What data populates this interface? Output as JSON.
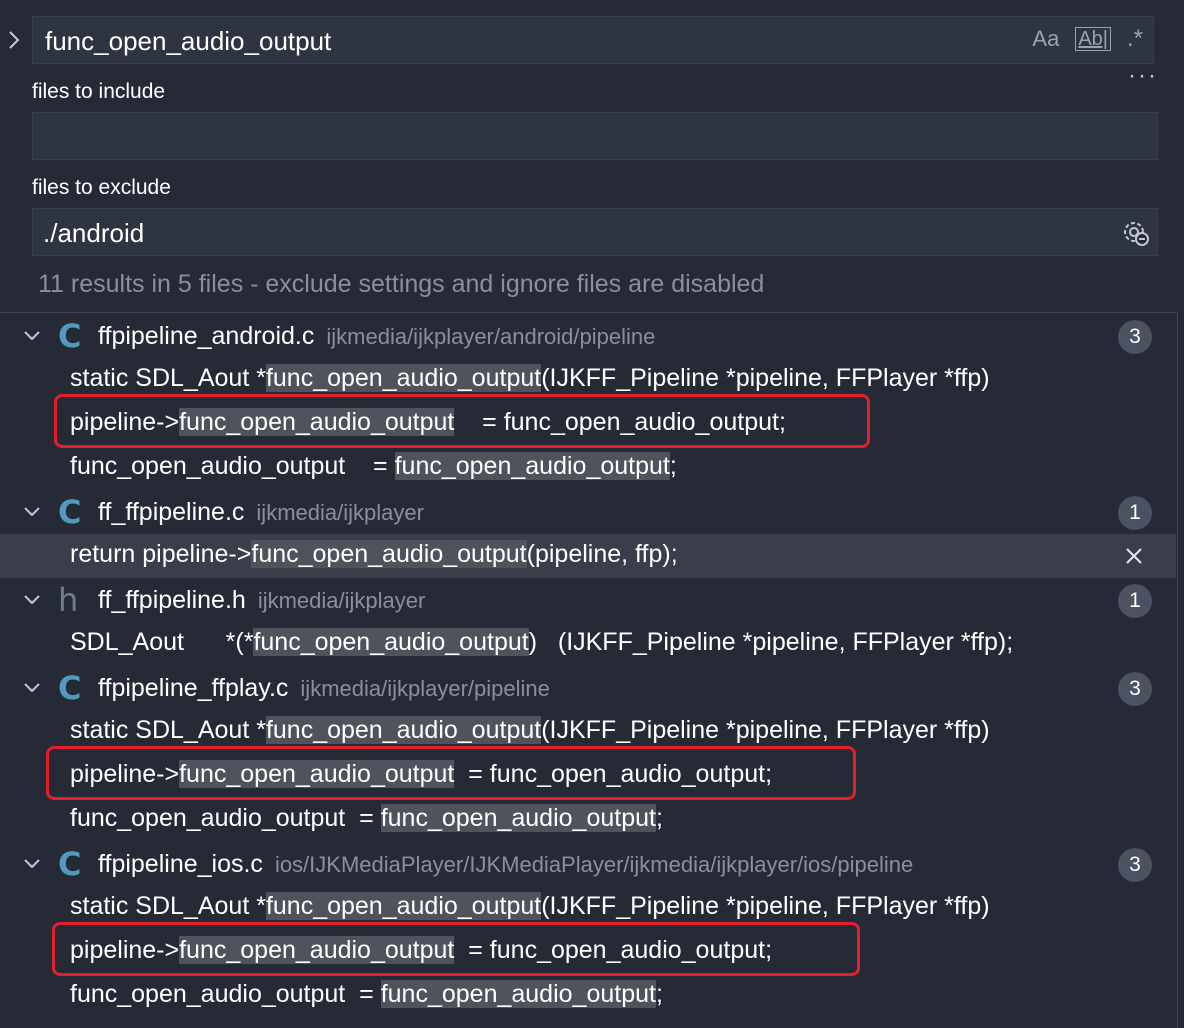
{
  "search": {
    "query": "func_open_audio_output",
    "match_case_label": "Aa",
    "whole_word_label": "Ab|",
    "regex_label": ".*",
    "more_label": "···"
  },
  "include": {
    "label": "files to include",
    "value": ""
  },
  "exclude": {
    "label": "files to exclude",
    "value": "./android"
  },
  "summary": "11 results in 5 files - exclude settings and ignore files are disabled",
  "files": [
    {
      "icon": "C",
      "name": "ffpipeline_android.c",
      "path": "ijkmedia/ijkplayer/android/pipeline",
      "count": "3",
      "lines": [
        {
          "pre": "static SDL_Aout *",
          "match": "func_open_audio_output",
          "post": "(IJKFF_Pipeline *pipeline, FFPlayer *ffp)"
        },
        {
          "pre": "pipeline->",
          "match": "func_open_audio_output",
          "post": "    = func_open_audio_output;"
        },
        {
          "pre": "func_open_audio_output    = ",
          "match": "func_open_audio_output",
          "post": ";"
        }
      ]
    },
    {
      "icon": "C",
      "name": "ff_ffpipeline.c",
      "path": "ijkmedia/ijkplayer",
      "count": "1",
      "lines": [
        {
          "pre": "return pipeline->",
          "match": "func_open_audio_output",
          "post": "(pipeline, ffp);"
        }
      ]
    },
    {
      "icon": "h",
      "name": "ff_ffpipeline.h",
      "path": "ijkmedia/ijkplayer",
      "count": "1",
      "lines": [
        {
          "pre": "SDL_Aout      *(*",
          "match": "func_open_audio_output",
          "post": ")   (IJKFF_Pipeline *pipeline, FFPlayer *ffp);"
        }
      ]
    },
    {
      "icon": "C",
      "name": "ffpipeline_ffplay.c",
      "path": "ijkmedia/ijkplayer/pipeline",
      "count": "3",
      "lines": [
        {
          "pre": "static SDL_Aout *",
          "match": "func_open_audio_output",
          "post": "(IJKFF_Pipeline *pipeline, FFPlayer *ffp)"
        },
        {
          "pre": "pipeline->",
          "match": "func_open_audio_output",
          "post": "  = func_open_audio_output;"
        },
        {
          "pre": "func_open_audio_output  = ",
          "match": "func_open_audio_output",
          "post": ";"
        }
      ]
    },
    {
      "icon": "C",
      "name": "ffpipeline_ios.c",
      "path": "ios/IJKMediaPlayer/IJKMediaPlayer/ijkmedia/ijkplayer/ios/pipeline",
      "count": "3",
      "lines": [
        {
          "pre": "static SDL_Aout *",
          "match": "func_open_audio_output",
          "post": "(IJKFF_Pipeline *pipeline, FFPlayer *ffp)"
        },
        {
          "pre": "pipeline->",
          "match": "func_open_audio_output",
          "post": "  = func_open_audio_output;"
        },
        {
          "pre": "func_open_audio_output  = ",
          "match": "func_open_audio_output",
          "post": ";"
        }
      ]
    }
  ],
  "colors": {
    "background": "#262a37",
    "highlight": "#50535b",
    "annotation": "#e0202a",
    "c_icon": "#519aba"
  }
}
